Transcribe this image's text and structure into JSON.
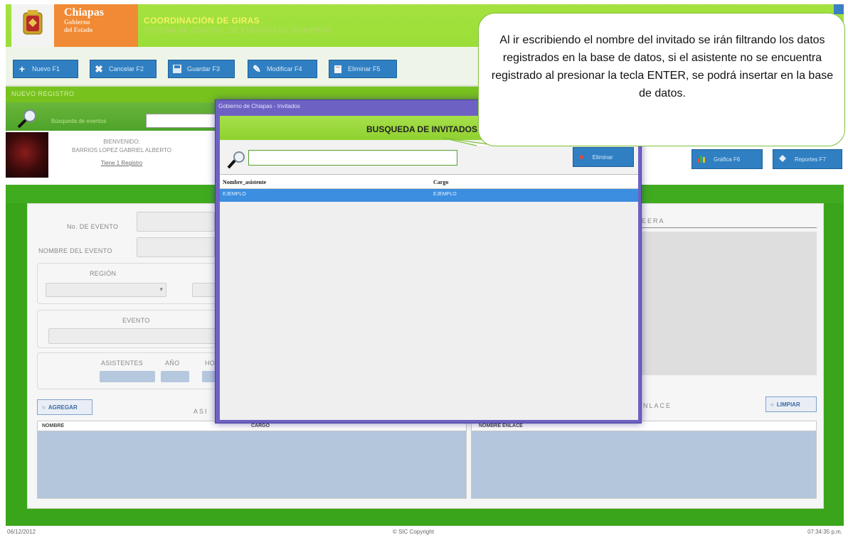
{
  "header": {
    "brand_line1": "Chiapas",
    "brand_line2": "Gobierno",
    "brand_line3": "del Estado",
    "app_title": "COORDINACIÓN DE GIRAS",
    "app_subtitle": "SISTEMA DE CONTROL DE EVENTOS DE GOBIERNO"
  },
  "toolbar": {
    "buttons": [
      {
        "label": "Nuevo F1",
        "icon": "plus-icon"
      },
      {
        "label": "Cancelar F2",
        "icon": "x-icon"
      },
      {
        "label": "Guardar F3",
        "icon": "save-icon"
      },
      {
        "label": "Modificar F4",
        "icon": "pencil-icon"
      },
      {
        "label": "Eliminar F5",
        "icon": "delete-icon"
      }
    ]
  },
  "section": {
    "title": "NUEVO REGISTRO"
  },
  "search": {
    "label": "Búsqueda de eventos"
  },
  "user": {
    "welcome": "BIENVENIDO:",
    "name": "BARRIOS LOPEZ GABRIEL ALBERTO",
    "link": "Tiene 1 Registro"
  },
  "right_buttons": [
    {
      "label": "Gráfica F6"
    },
    {
      "label": "Reportes F7"
    }
  ],
  "form": {
    "num_evento_label": "No. DE EVENTO",
    "nombre_evento_label": "NOMBRE DEL EVENTO",
    "region_label": "REGIÓN",
    "evento_label": "EVENTO",
    "asistentes_label": "ASISTENTES",
    "anio_label": "AÑO",
    "hora_label": "HO",
    "right_panel_title": "EERA",
    "agregar_label": "AGREGAR",
    "asistentes_section_label": "ASI",
    "enlace_label": "NLACE",
    "limpiar_label": "LIMPIAR",
    "grid_left_cols": [
      "NOMBRE",
      "CARGO"
    ],
    "grid_right_cols": [
      "NOMBRE ENLACE"
    ]
  },
  "dialog": {
    "title": "Gobierno de Chiapas - Invitados",
    "heading": "BUSQUEDA DE INVITADOS",
    "eliminar_label": "Eliminar",
    "columns": [
      "Nombre_asistente",
      "Cargo"
    ],
    "rows": [
      {
        "nombre": "EJEMPLO",
        "cargo": "EJEMPLO"
      }
    ]
  },
  "callout": {
    "text": "Al ir escribiendo el nombre del invitado se irán filtrando los datos registrados en la base de datos, si el asistente no se encuentra registrado al presionar la tecla ENTER, se podrá insertar en la base de datos."
  },
  "footer": {
    "date": "06/12/2012",
    "copyright": "© SIC Copyright",
    "time": "07:34:35 p.m."
  },
  "colors": {
    "header_green": "#a4e23f",
    "body_green": "#3aa51a",
    "brand_orange": "#f08a35",
    "button_blue": "#2f7fc2",
    "dialog_purple": "#6d62c4",
    "selected_row": "#3b8ee0"
  }
}
